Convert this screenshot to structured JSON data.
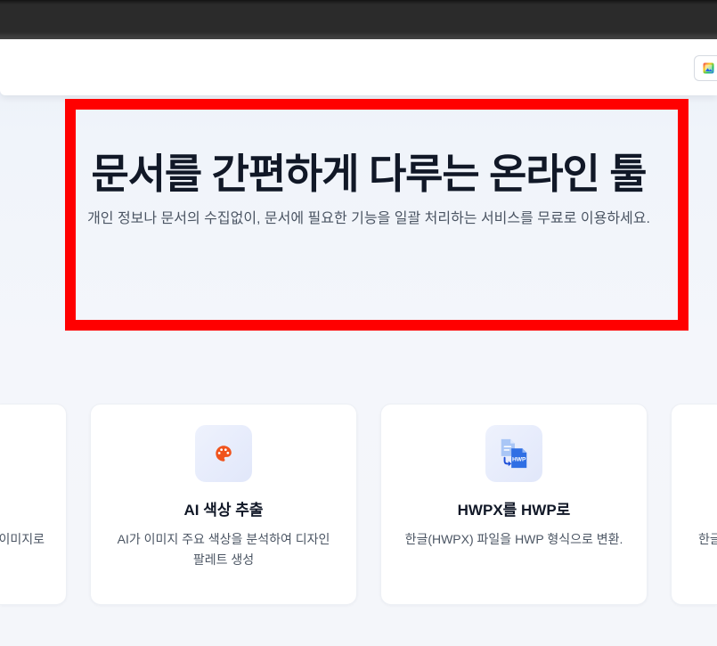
{
  "header": {
    "gallery_button": {
      "icon": "gallery-icon"
    }
  },
  "hero": {
    "title": "문서를 간편하게 다루는 온라인 툴",
    "subtitle": "개인 정보나 문서의 수집없이, 문서에 필요한 기능을 일괄 처리하는 서비스를 무료로 이용하세요."
  },
  "tools": [
    {
      "description_visible": "이미지로"
    },
    {
      "icon": "palette-icon",
      "title": "AI 색상 추출",
      "description": "AI가 이미지 주요 색상을 분석하여 디자인 팔레트 생성"
    },
    {
      "icon": "hwpx-to-hwp-icon",
      "icon_label": "HWP",
      "title": "HWPX를 HWP로",
      "description": "한글(HWPX) 파일을 HWP 형식으로 변환."
    },
    {
      "description_visible": "한글"
    }
  ],
  "colors": {
    "highlight_outline": "#ff0000",
    "heading_text": "#111827",
    "body_text": "#4b5563",
    "palette_icon": "#f0531c",
    "hwp_blue": "#2f6fe4"
  }
}
